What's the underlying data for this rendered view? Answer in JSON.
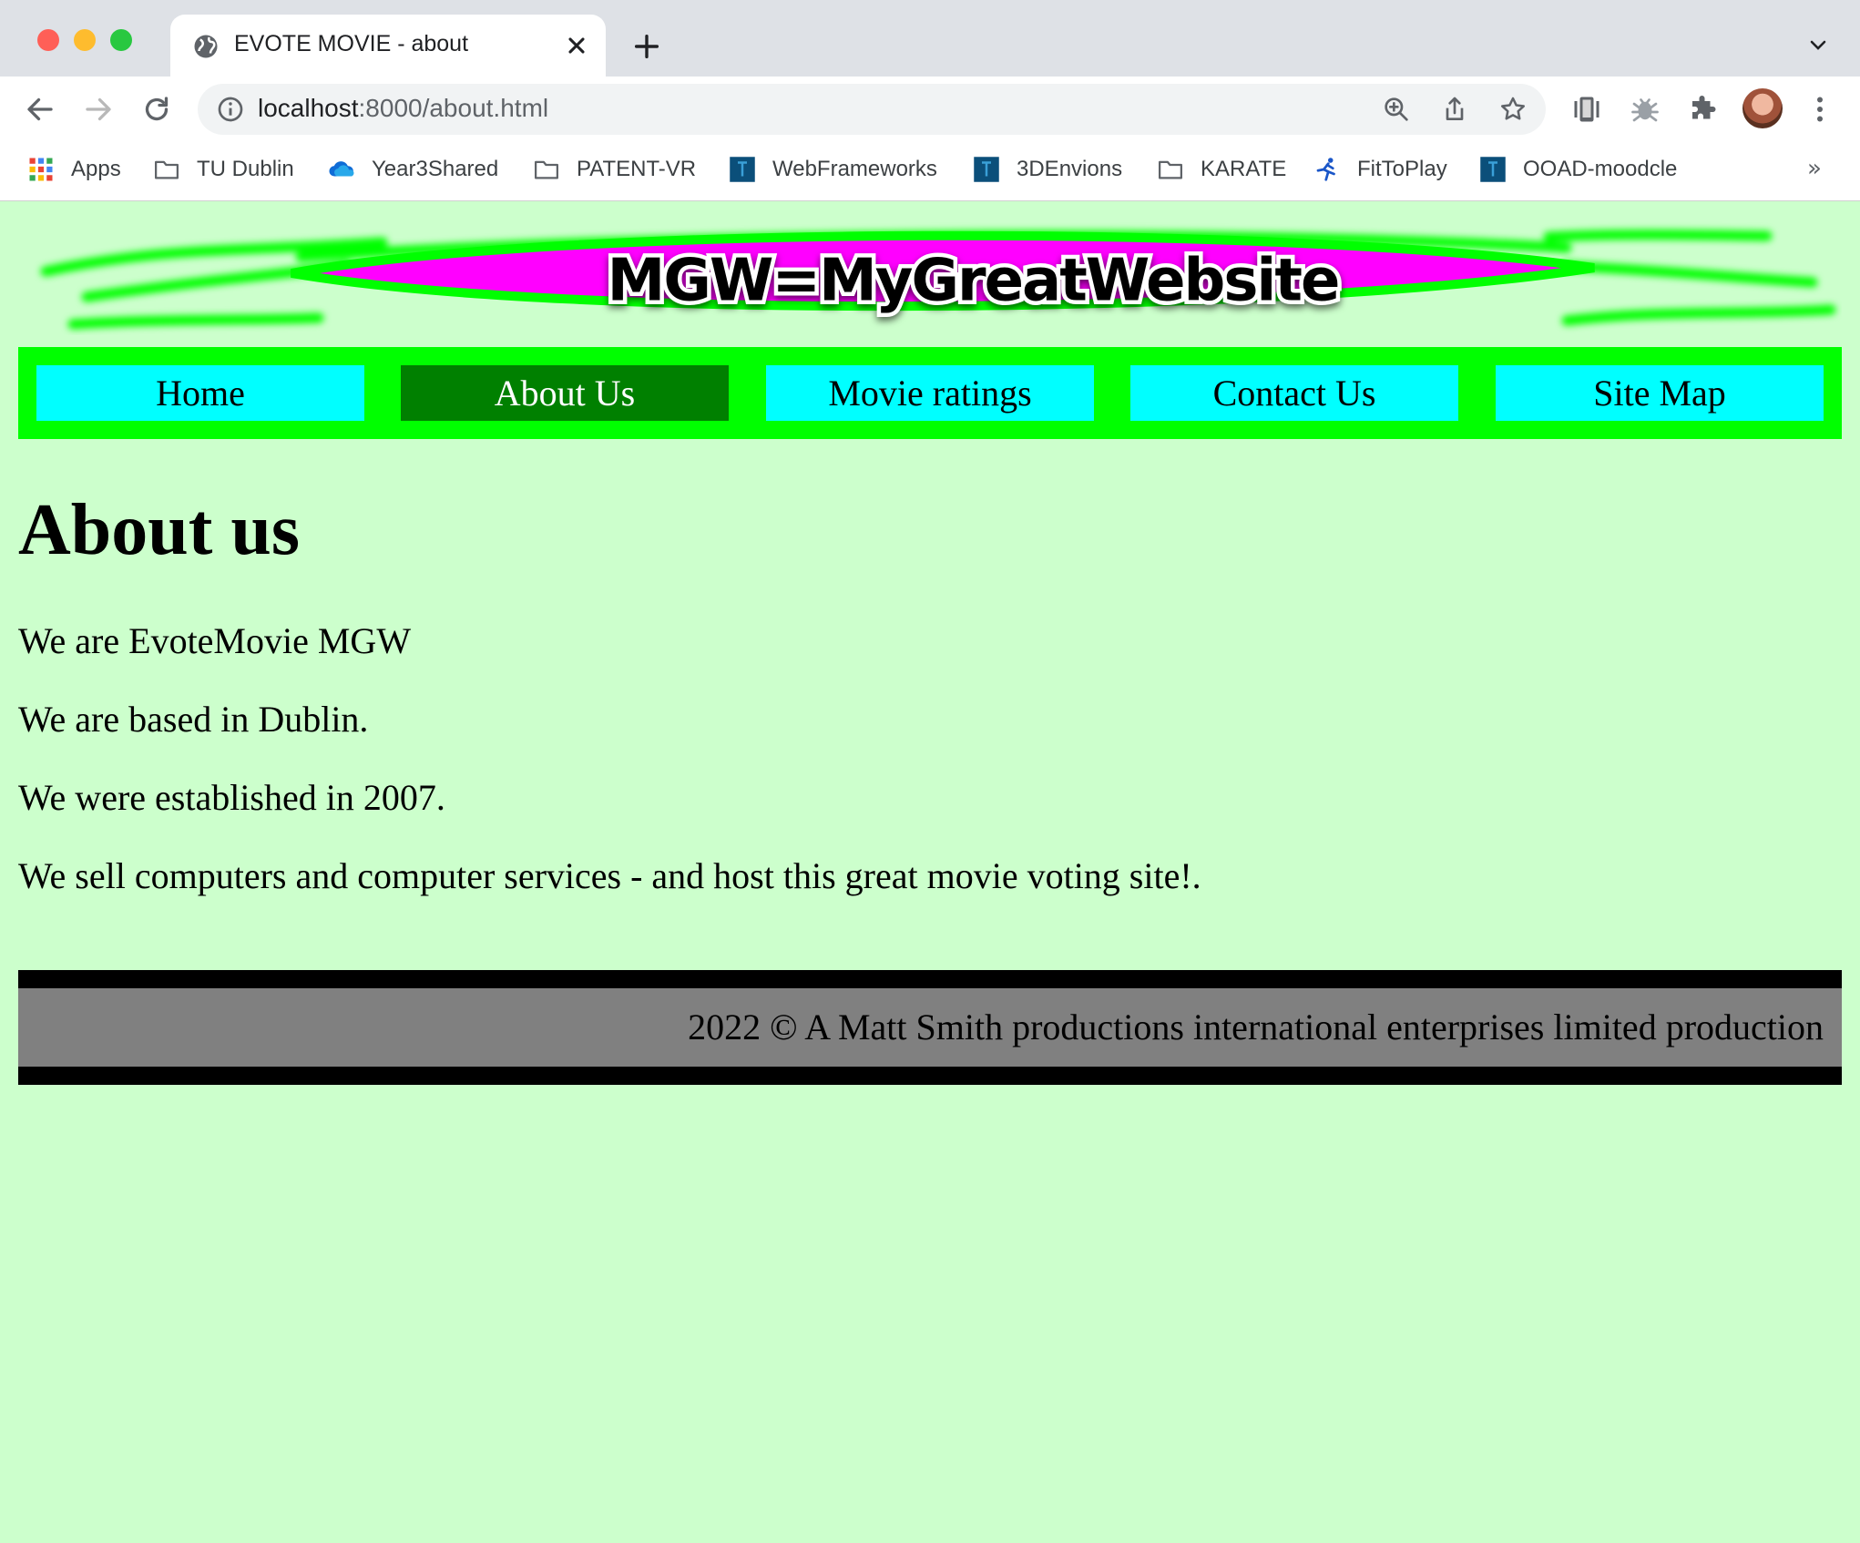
{
  "browser": {
    "tab_title": "EVOTE MOVIE - about",
    "url_host": "localhost",
    "url_rest": ":8000/about.html",
    "bookmarks": [
      {
        "label": "Apps",
        "icon": "apps-grid-icon"
      },
      {
        "label": "TU Dublin",
        "icon": "folder-icon"
      },
      {
        "label": "Year3Shared",
        "icon": "onedrive-cloud-icon"
      },
      {
        "label": "PATENT-VR",
        "icon": "folder-icon"
      },
      {
        "label": "WebFrameworks",
        "icon": "site-favicon"
      },
      {
        "label": "3DEnvions",
        "icon": "site-favicon"
      },
      {
        "label": "KARATE",
        "icon": "folder-icon"
      },
      {
        "label": "FitToPlay",
        "icon": "runner-icon"
      },
      {
        "label": "OOAD-moodcle",
        "icon": "site-favicon"
      }
    ],
    "bookmarks_overflow": "»"
  },
  "site": {
    "banner_text": "MGW=MyGreatWebsite",
    "nav": [
      {
        "label": "Home",
        "active": false
      },
      {
        "label": "About Us",
        "active": true
      },
      {
        "label": "Movie ratings",
        "active": false
      },
      {
        "label": "Contact Us",
        "active": false
      },
      {
        "label": "Site Map",
        "active": false
      }
    ],
    "heading": "About us",
    "paragraphs": [
      "We are EvoteMovie MGW",
      "We are based in Dublin.",
      "We were established in 2007.",
      "We sell computers and computer services - and host this great movie voting site!."
    ],
    "footer": "2022 © A Matt Smith productions international enterprises limited production"
  },
  "colors": {
    "page_background": "#ccffcc",
    "nav_bar": "#00ff00",
    "nav_item": "#00ffff",
    "nav_item_active": "#008000",
    "footer_background": "#808080",
    "banner_magenta": "#ff00ff"
  }
}
